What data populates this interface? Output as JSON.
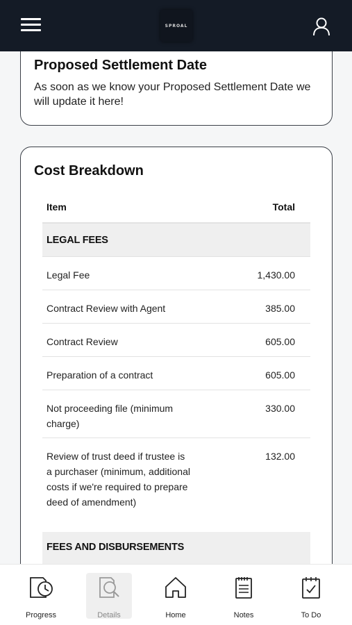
{
  "header": {
    "logo_text": "SPROAL"
  },
  "settlement": {
    "title": "Proposed Settlement Date",
    "message": "As soon as we know your Proposed Settlement Date we will update it here!"
  },
  "cost": {
    "title": "Cost Breakdown",
    "col_item": "Item",
    "col_total": "Total",
    "section1": "LEGAL FEES",
    "rows": [
      {
        "item": "Legal Fee",
        "total": "1,430.00"
      },
      {
        "item": "Contract Review with Agent",
        "total": "385.00"
      },
      {
        "item": "Contract Review",
        "total": "605.00"
      },
      {
        "item": "Preparation of a contract",
        "total": "605.00"
      },
      {
        "item": "Not proceeding file (minimum charge)",
        "total": "330.00"
      },
      {
        "item": "Review of trust deed if trustee is a purchaser (minimum, additional costs if we're required to prepare deed of amendment)",
        "total": "132.00"
      }
    ],
    "section2": "FEES AND DISBURSEMENTS"
  },
  "nav": {
    "items": [
      {
        "label": "Progress",
        "icon": "progress-icon"
      },
      {
        "label": "Details",
        "icon": "details-icon"
      },
      {
        "label": "Home",
        "icon": "home-icon"
      },
      {
        "label": "Notes",
        "icon": "notes-icon"
      },
      {
        "label": "To Do",
        "icon": "todo-icon"
      }
    ],
    "active": "Details"
  }
}
